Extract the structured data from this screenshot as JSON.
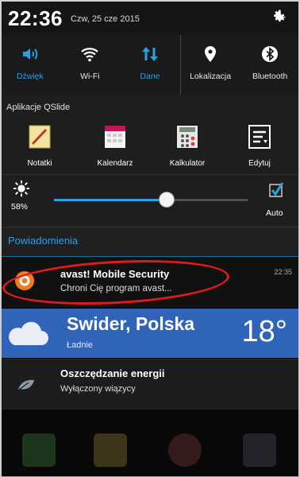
{
  "status_bar": {
    "time": "22:36",
    "date": "Czw, 25 cze 2015",
    "settings_icon": "gear-icon"
  },
  "quick_toggles": [
    {
      "label": "Dźwięk",
      "icon": "speaker-icon",
      "state": "on"
    },
    {
      "label": "Wi-Fi",
      "icon": "wifi-icon",
      "state": "off"
    },
    {
      "label": "Dane",
      "icon": "data-arrows-icon",
      "state": "on"
    },
    {
      "label": "Lokalizacja",
      "icon": "location-pin-icon",
      "state": "off"
    },
    {
      "label": "Bluetooth",
      "icon": "bluetooth-icon",
      "state": "off"
    }
  ],
  "qslide": {
    "title": "Aplikacje QSlide",
    "apps": [
      {
        "label": "Notatki",
        "icon": "notes-icon"
      },
      {
        "label": "Kalendarz",
        "icon": "calendar-icon"
      },
      {
        "label": "Kalkulator",
        "icon": "calculator-icon"
      },
      {
        "label": "Edytuj",
        "icon": "edit-list-icon"
      }
    ]
  },
  "brightness": {
    "percent_label": "58%",
    "level": 0.58,
    "auto_label": "Auto",
    "auto_checked": true
  },
  "notifications": {
    "header": "Powiadomienia",
    "avast": {
      "title": "avast! Mobile Security",
      "subtitle": "Chroni Cię program avast...",
      "time": "22:35"
    },
    "weather": {
      "city": "Swider, Polska",
      "condition": "Ładnie",
      "temperature": "18°"
    },
    "energy": {
      "title": "Oszczędzanie energii",
      "subtitle": "Wyłączony wiązycy"
    }
  },
  "colors": {
    "accent": "#2aa0e6",
    "weather_bg": "#2f64b8",
    "annotation": "#e01b1b"
  }
}
